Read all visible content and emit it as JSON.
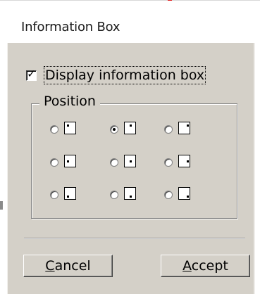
{
  "window": {
    "title": "Information Box"
  },
  "display_checkbox": {
    "label": "Display information box",
    "checked": true,
    "mark": "✓"
  },
  "position_group": {
    "legend": "Position",
    "selected": "top-center",
    "options": [
      {
        "id": "top-left"
      },
      {
        "id": "top-center"
      },
      {
        "id": "top-right"
      },
      {
        "id": "middle-left"
      },
      {
        "id": "middle-center"
      },
      {
        "id": "middle-right"
      },
      {
        "id": "bottom-left"
      },
      {
        "id": "bottom-center"
      },
      {
        "id": "bottom-right"
      }
    ]
  },
  "buttons": {
    "cancel": {
      "mnemonic": "C",
      "rest": "ancel"
    },
    "accept": {
      "mnemonic": "A",
      "rest": "ccept"
    }
  },
  "colors": {
    "dialog_bg": "#d4d0c8",
    "window_bg": "#ffffff"
  }
}
